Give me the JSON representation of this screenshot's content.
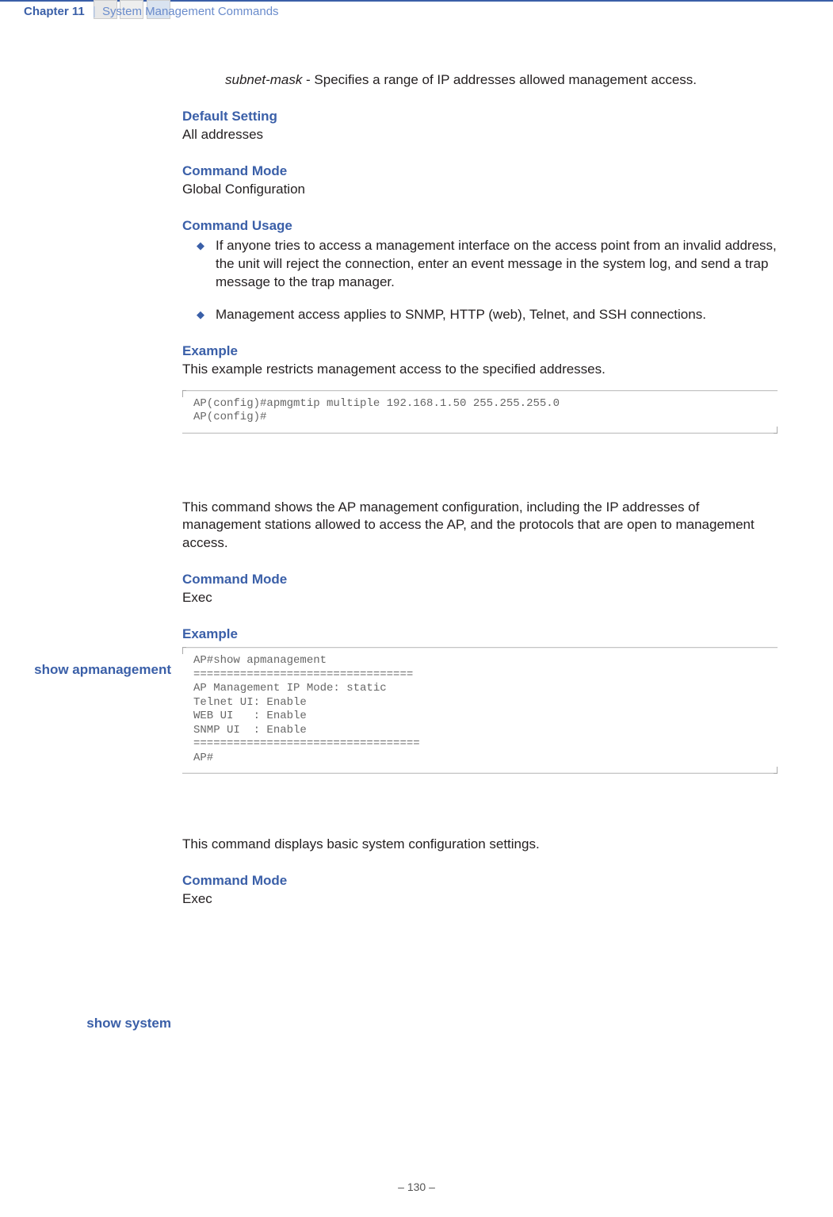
{
  "header": {
    "chapter": "Chapter 11",
    "title": "System Management Commands"
  },
  "intro": {
    "subnet_term": "subnet-mask",
    "subnet_desc": " - Specifies a range of IP addresses allowed management access.",
    "default_head": "Default Setting",
    "default_val": "All addresses",
    "cmdmode_head": "Command Mode",
    "cmdmode_val": "Global Configuration",
    "usage_head": "Command Usage",
    "usage_b1": "If anyone tries to access a management interface on the access point from an invalid address, the unit will reject the connection, enter an event message in the system log, and send a trap message to the trap manager.",
    "usage_b2": "Management access applies to SNMP, HTTP (web), Telnet, and SSH connections.",
    "example_head": "Example",
    "example_desc": "This example restricts management access to the specified addresses.",
    "example_code": "AP(config)#apmgmtip multiple 192.168.1.50 255.255.255.0\nAP(config)#"
  },
  "apm": {
    "label": "show apmanagement",
    "desc": "This command shows the AP management configuration, including the IP addresses of management stations allowed to access the AP, and the protocols that are open to management access.",
    "cmdmode_head": "Command Mode",
    "cmdmode_val": "Exec",
    "example_head": "Example",
    "example_code": "AP#show apmanagement\n=================================\nAP Management IP Mode: static\nTelnet UI: Enable\nWEB UI   : Enable\nSNMP UI  : Enable\n==================================\nAP#"
  },
  "sys": {
    "label": "show system",
    "desc": "This command displays basic system configuration settings.",
    "cmdmode_head": "Command Mode",
    "cmdmode_val": "Exec"
  },
  "footer": "–  130  –"
}
